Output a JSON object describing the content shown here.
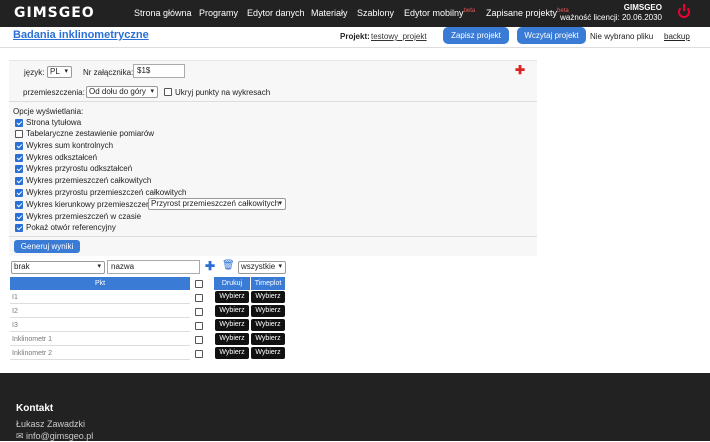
{
  "header": {
    "logo": "GIMSGEO",
    "nav": [
      "Strona główna",
      "Programy",
      "Edytor danych",
      "Materiały",
      "Szablony",
      "Edytor mobilny",
      "Zapisane projekty"
    ],
    "beta": "beta",
    "brand": "GIMSGEO",
    "license": "ważność licencji: 20.06.2030"
  },
  "page": {
    "title": "Badania inklinometryczne",
    "project_label": "Projekt:",
    "project_name": "testowy_projekt",
    "save_btn": "Zapisz projekt",
    "load_btn": "Wczytaj projekt",
    "no_file": "Nie wybrano pliku",
    "backup": "backup"
  },
  "form": {
    "lang_label": "język:",
    "lang_value": "PL",
    "att_label": "Nr załącznika:",
    "att_value": "$1$",
    "disp_label": "przemieszczenia:",
    "disp_value": "Od dołu do góry",
    "hide_label": "Ukryj punkty na wykresach",
    "options_title": "Opcje wyświetlania:",
    "options": [
      {
        "label": "Strona tytułowa",
        "checked": true
      },
      {
        "label": "Tabelaryczne zestawienie pomiarów",
        "checked": false
      },
      {
        "label": "Wykres sum kontrolnych",
        "checked": true
      },
      {
        "label": "Wykres odkształceń",
        "checked": true
      },
      {
        "label": "Wykres przyrostu odkształceń",
        "checked": true
      },
      {
        "label": "Wykres przemieszczeń całkowitych",
        "checked": true
      },
      {
        "label": "Wykres przyrostu przemieszczeń całkowitych",
        "checked": true
      },
      {
        "label": "Wykres kierunkowy przemieszczeń",
        "checked": true
      },
      {
        "label": "Wykres przemieszczeń w czasie",
        "checked": true
      },
      {
        "label": "Pokaż otwór referencyjny",
        "checked": true
      }
    ],
    "dir_select": "Przyrost przemieszczeń całkowitych",
    "generate_btn": "Generuj wyniki"
  },
  "filter": {
    "type_value": "brak",
    "name_placeholder": "nazwa",
    "scope_value": "wszystkie"
  },
  "table": {
    "col_pkt": "Pkt",
    "col_print": "Drukuj",
    "col_timeplot": "Timeplot",
    "btn_label": "Wybierz",
    "rows": [
      "I1",
      "I2",
      "I3",
      "Inklinometr 1",
      "Inklinometr 2"
    ]
  },
  "footer": {
    "title": "Kontakt",
    "name": "Łukasz Zawadzki",
    "email": "info@gimsgeo.pl"
  }
}
